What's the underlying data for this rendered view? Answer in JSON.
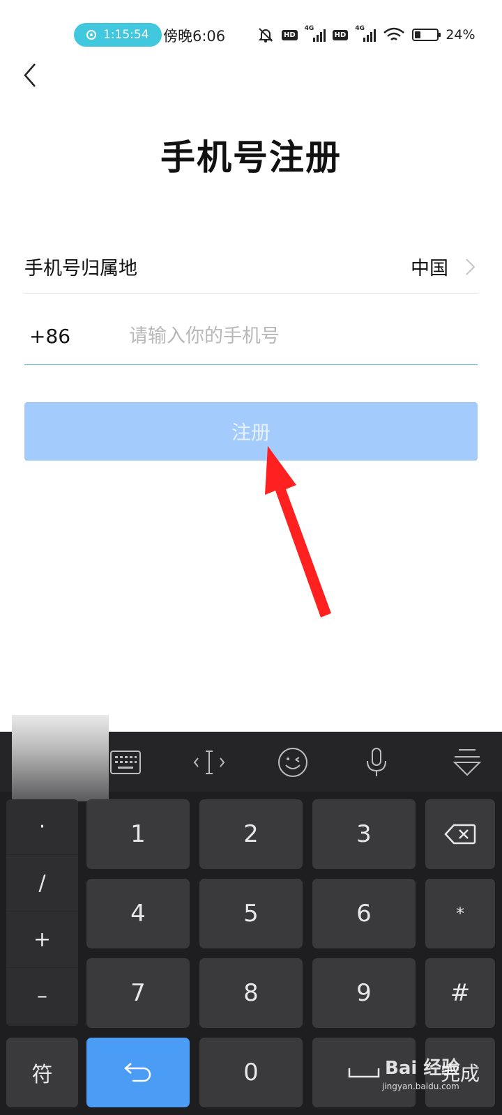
{
  "status_bar": {
    "recording_time": "1:15:54",
    "time": "傍晚6:06",
    "hd_label": "HD",
    "network_label": "4G",
    "battery_text": "24%",
    "battery_level": 0.24
  },
  "header": {
    "title": "手机号注册"
  },
  "form": {
    "region_label": "手机号归属地",
    "region_value": "中国",
    "country_code": "+86",
    "phone_placeholder": "请输入你的手机号",
    "phone_value": "",
    "register_label": "注册"
  },
  "keyboard": {
    "toolbar_icons": [
      "keyboard-icon",
      "cursor-icon",
      "emoji-icon",
      "microphone-icon",
      "hide-keyboard-icon"
    ],
    "symbol_keys": [
      "·",
      "/",
      "+",
      "–"
    ],
    "digits": [
      "1",
      "2",
      "3",
      "4",
      "5",
      "6",
      "7",
      "8",
      "9",
      "0"
    ],
    "star": "*",
    "hash": "#",
    "symbols_label": "符",
    "done_label": "完成"
  },
  "watermark": {
    "text": "Bai 经验",
    "sub": "jingyan.baidu.com"
  },
  "colors": {
    "accent": "#4a9cf5",
    "register_disabled": "#a3cbfb",
    "recording_pill": "#41c8de",
    "annotation_arrow": "#ff2020"
  }
}
